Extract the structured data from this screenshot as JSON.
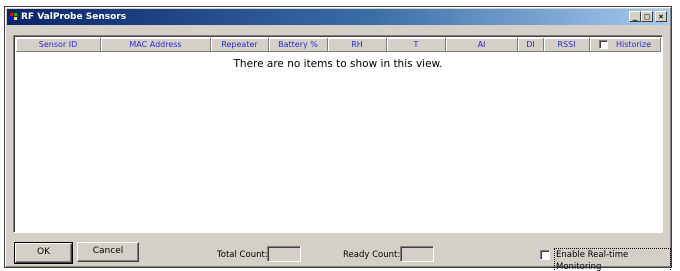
{
  "window": {
    "title": "RF ValProbe Sensors",
    "controls": {
      "minimize": "_",
      "maximize": "□",
      "close": "×"
    }
  },
  "list": {
    "columns": [
      "Sensor ID",
      "MAC Address",
      "Repeater",
      "Battery %",
      "RH",
      "T",
      "AI",
      "DI",
      "RSSI",
      "Historize"
    ],
    "empty_message": "There are no items to show in this view."
  },
  "footer": {
    "ok_label": "OK",
    "cancel_label": "Cancel",
    "total_count_label": "Total Count:",
    "total_count_value": "",
    "ready_count_label": "Ready Count:",
    "ready_count_value": "",
    "realtime_label": "Enable Real-time Monitoring",
    "realtime_checked": false
  },
  "colors": {
    "title_gradient_start": "#0a246a",
    "title_gradient_end": "#a6caf0",
    "header_text": "#2b2bd8",
    "face": "#d4d0c8"
  }
}
